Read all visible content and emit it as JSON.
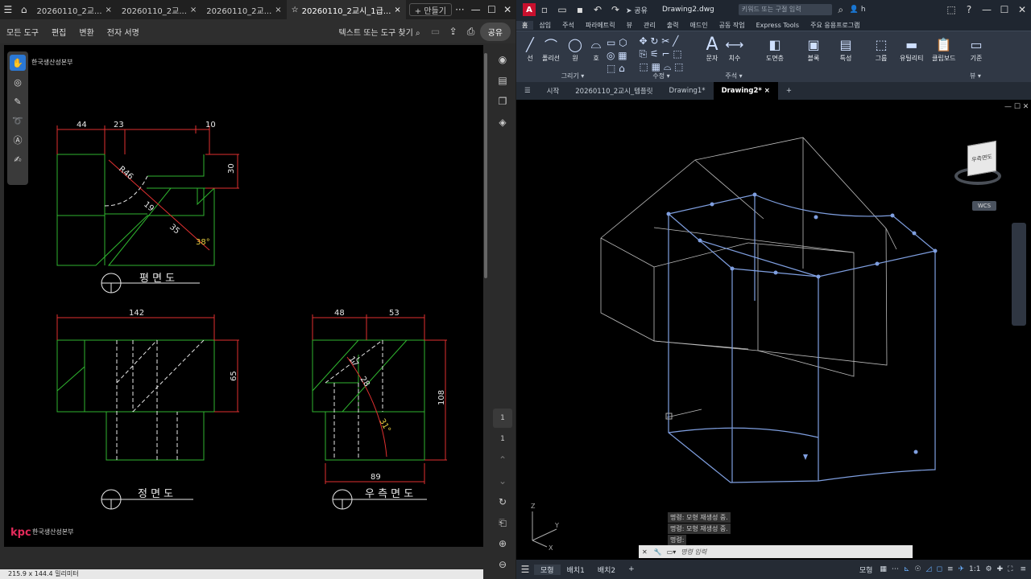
{
  "pdf": {
    "tabs": [
      "20260110_2교...",
      "20260110_2교...",
      "20260110_2교...",
      "20260110_2교시_1급..."
    ],
    "new_tab": "+ 만들기",
    "menu": [
      "모든 도구",
      "편집",
      "변환",
      "전자 서명"
    ],
    "search": "텍스트 또는 도구 찾기",
    "share": "공유",
    "brand": "한국생산성본부",
    "brand_logo": "kpc",
    "page_current": "1",
    "page_total": "1",
    "page_size": "215.9 x 144.4 밀리미터",
    "views": {
      "top": "평 면 도",
      "front": "정 면 도",
      "right": "우 측 면 도"
    },
    "dims": {
      "top_44": "44",
      "top_23": "23",
      "top_10": "10",
      "top_30": "30",
      "top_r46": "R46",
      "top_19": "19",
      "top_35": "35",
      "top_38": "38°",
      "front_142": "142",
      "front_65": "65",
      "right_48": "48",
      "right_53": "53",
      "right_108": "108",
      "right_17": "17",
      "right_28": "28",
      "right_31": "31°",
      "right_89": "89"
    }
  },
  "cad": {
    "title": "Drawing2.dwg",
    "share": "공유",
    "search_placeholder": "키워드 또는 구절 입력",
    "user": "h",
    "ribbon_tabs": [
      "홈",
      "삽입",
      "주석",
      "파라메트릭",
      "뷰",
      "관리",
      "출력",
      "애드인",
      "공동 작업",
      "Express Tools",
      "주요 응용프로그램"
    ],
    "tools": {
      "line": "선",
      "polyline": "폴리선",
      "circle": "원",
      "arc": "호",
      "text": "문자",
      "dim": "치수",
      "layer": "도면층",
      "block": "블록",
      "props": "특성",
      "group": "그룹",
      "utility": "유틸리티",
      "clipboard": "클립보드",
      "base": "기준"
    },
    "panels": {
      "draw": "그리기 ▾",
      "modify": "수정 ▾",
      "annot": "주석 ▾",
      "view": "뷰 ▾"
    },
    "file_tabs": [
      "시작",
      "20260110_2교시_템플릿",
      "Drawing1*",
      "Drawing2*"
    ],
    "viewcube": "우측면도",
    "wcs": "WCS",
    "cmd_history": [
      "명령:  모형 재생성 중.",
      "명령:  모형 재생성 중.",
      "명령:"
    ],
    "cmd_input": "명령 입력",
    "status": {
      "model": "모형",
      "layout1": "배치1",
      "layout2": "배치2",
      "model_btn": "모형",
      "scale": "1:1"
    }
  }
}
